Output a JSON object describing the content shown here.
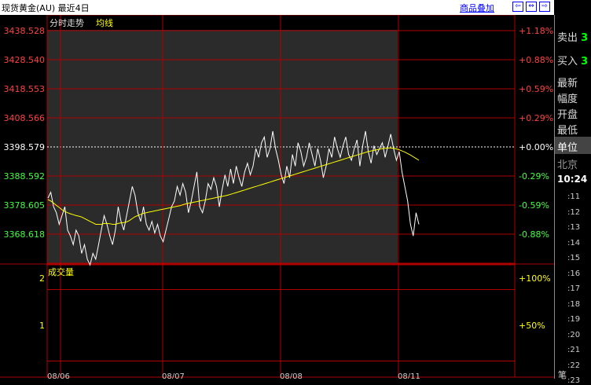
{
  "window": {
    "title": "现货黄金(AU) 最近4日",
    "link": "商品叠加",
    "icons": [
      "zoom-in-icon",
      "restore-icon",
      "zoom-out-icon"
    ]
  },
  "chart_data": {
    "type": "line",
    "legend": {
      "label": "分时走势",
      "ma_label": "均线"
    },
    "price_axis": {
      "ticks": [
        3438.528,
        3428.54,
        3418.553,
        3408.566,
        3398.579,
        3388.592,
        3378.605,
        3368.618
      ],
      "tick_labels": [
        "3438.528",
        "3428.540",
        "3418.553",
        "3408.566",
        "3398.579",
        "3388.592",
        "3378.605",
        "3368.618"
      ],
      "pct_labels": [
        "+1.18%",
        "+0.88%",
        "+0.59%",
        "+0.29%",
        "+0.00%",
        "-0.29%",
        "-0.59%",
        "-0.88%"
      ],
      "baseline": 3398.579
    },
    "x_labels": [
      "08/06",
      "08/07",
      "08/08",
      "08/11"
    ],
    "series": [
      {
        "values": [
          3381,
          3383,
          3378,
          3376,
          3372,
          3375,
          3378,
          3370,
          3368,
          3365,
          3370,
          3368,
          3362,
          3365,
          3360,
          3358,
          3362,
          3360,
          3365,
          3370,
          3375,
          3372,
          3368,
          3365,
          3370,
          3378,
          3373,
          3370,
          3375,
          3380,
          3385,
          3382,
          3376,
          3373,
          3378,
          3372,
          3370,
          3373,
          3369,
          3372,
          3368,
          3366,
          3370,
          3374,
          3378,
          3380,
          3385,
          3382,
          3386,
          3383,
          3376,
          3380,
          3385,
          3390,
          3378,
          3376,
          3380,
          3386,
          3384,
          3388,
          3385,
          3378,
          3384,
          3389,
          3385,
          3391,
          3386,
          3392,
          3388,
          3385,
          3390,
          3393,
          3389,
          3392,
          3398,
          3395,
          3400,
          3402,
          3395,
          3398,
          3404,
          3398,
          3394,
          3389,
          3386,
          3392,
          3388,
          3396,
          3392,
          3400,
          3397,
          3392,
          3395,
          3400,
          3396,
          3392,
          3398,
          3394,
          3388,
          3392,
          3398,
          3395,
          3402,
          3398,
          3395,
          3399,
          3402,
          3396,
          3394,
          3398,
          3401,
          3392,
          3399,
          3404,
          3397,
          3393,
          3399,
          3396,
          3398,
          3400,
          3395,
          3399,
          3403,
          3398,
          3394,
          3397,
          3390,
          3385,
          3380,
          3372,
          3368,
          3376,
          3372
        ],
        "ma": [
          3380.5,
          3380,
          3379.3,
          3378.5,
          3377.8,
          3377,
          3376.4,
          3376,
          3375.6,
          3375.3,
          3375,
          3374.8,
          3374.5,
          3374,
          3373.5,
          3373,
          3372.5,
          3372,
          3372,
          3372,
          3372.3,
          3372.3,
          3372.2,
          3372,
          3372,
          3372.3,
          3372.5,
          3372.6,
          3372.8,
          3373.3,
          3374,
          3374.6,
          3375,
          3375.4,
          3375.8,
          3376,
          3376.2,
          3376.4,
          3376.6,
          3376.8,
          3377,
          3377.2,
          3377.4,
          3377.6,
          3377.8,
          3378,
          3378.2,
          3378.4,
          3378.7,
          3379,
          3379.2,
          3379.4,
          3379.6,
          3379.8,
          3380,
          3380.2,
          3380.4,
          3380.6,
          3380.8,
          3381,
          3381.2,
          3381.4,
          3381.6,
          3381.8,
          3382,
          3382.3,
          3382.6,
          3382.9,
          3383.2,
          3383.5,
          3383.8,
          3384.1,
          3384.4,
          3384.7,
          3385,
          3385.3,
          3385.6,
          3385.9,
          3386.2,
          3386.5,
          3386.8,
          3387.1,
          3387.4,
          3387.7,
          3388,
          3388.3,
          3388.6,
          3388.9,
          3389.2,
          3389.5,
          3389.8,
          3390.1,
          3390.4,
          3390.7,
          3391,
          3391.3,
          3391.6,
          3391.9,
          3392.2,
          3392.5,
          3392.8,
          3393.1,
          3393.4,
          3393.7,
          3394,
          3394.3,
          3394.6,
          3394.9,
          3395.2,
          3395.5,
          3395.8,
          3396.1,
          3396.4,
          3396.7,
          3397,
          3397.2,
          3397.4,
          3397.6,
          3397.8,
          3398,
          3398.1,
          3398.2,
          3398.2,
          3398.1,
          3397.9,
          3397.6,
          3397.2,
          3396.8,
          3396.3,
          3395.8,
          3395.2,
          3394.6,
          3394
        ]
      }
    ],
    "volume_panel": {
      "label": "成交量",
      "ticks": [
        "2",
        "1"
      ],
      "pct_labels": [
        "+100%",
        "+50%"
      ]
    }
  },
  "right_panel": {
    "sell_label": "卖出",
    "sell_value": "3",
    "buy_label": "买入",
    "buy_value": "3",
    "labels": [
      "最新",
      "幅度",
      "开盘",
      "最低"
    ],
    "unit_label": "单位",
    "city": "北京",
    "time": "10:24",
    "ticks": [
      ":11",
      ":12",
      ":13",
      ":14",
      ":15",
      ":16",
      ":17",
      ":18",
      ":19",
      ":20",
      ":21",
      ":22",
      ":23"
    ],
    "bottom": "笔"
  }
}
